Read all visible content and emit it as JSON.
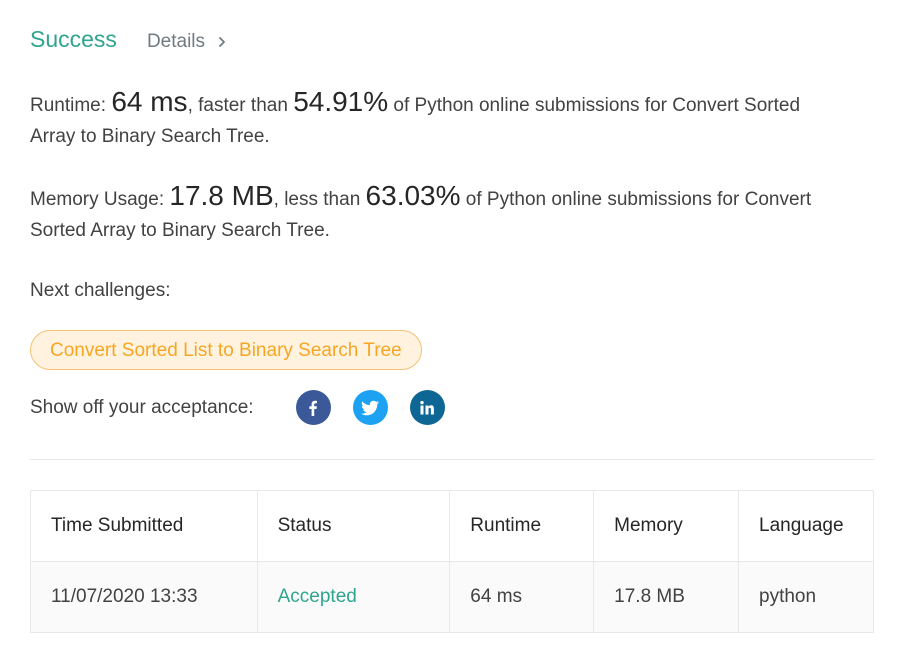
{
  "header": {
    "status": "Success",
    "details_label": "Details"
  },
  "runtime": {
    "label": "Runtime: ",
    "value": "64 ms",
    "comparison": ", faster than ",
    "percent": "54.91%",
    "suffix": " of Python online submissions for Convert Sorted Array to Binary Search Tree."
  },
  "memory": {
    "label": "Memory Usage: ",
    "value": "17.8 MB",
    "comparison": ", less than ",
    "percent": "63.03%",
    "suffix": " of Python online submissions for Convert Sorted Array to Binary Search Tree."
  },
  "next": {
    "label": "Next challenges:",
    "challenge": "Convert Sorted List to Binary Search Tree"
  },
  "share": {
    "label": "Show off your acceptance:",
    "icons": [
      "facebook-icon",
      "twitter-icon",
      "linkedin-icon"
    ],
    "colors": {
      "facebook": "#3b5998",
      "twitter": "#1da1f2",
      "linkedin": "#0e6695"
    }
  },
  "table": {
    "headers": [
      "Time Submitted",
      "Status",
      "Runtime",
      "Memory",
      "Language"
    ],
    "rows": [
      [
        "11/07/2020 13:33",
        "Accepted",
        "64 ms",
        "17.8 MB",
        "python"
      ]
    ]
  },
  "colors": {
    "success": "#2fa58e",
    "challenge_text": "#f6a623",
    "challenge_bg": "#fff3e0",
    "challenge_border": "#f5c074"
  }
}
